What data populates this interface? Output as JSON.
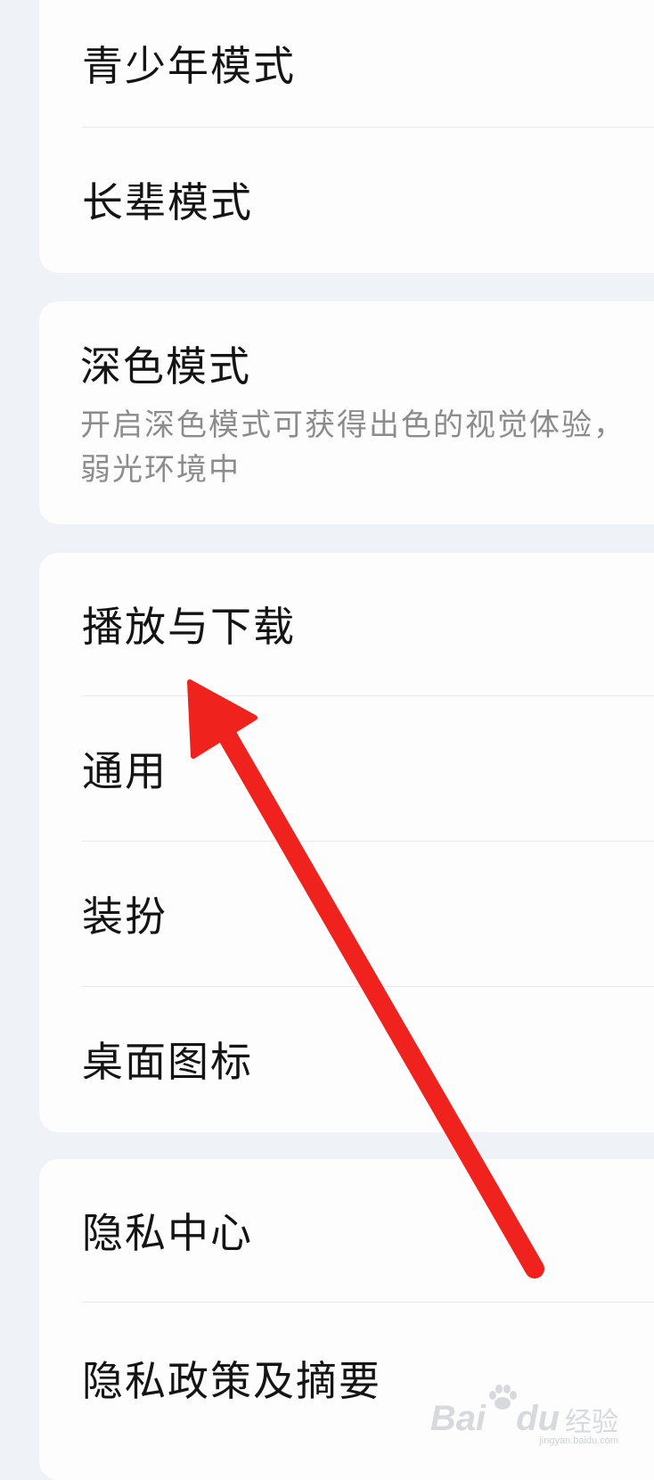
{
  "groups": [
    {
      "items": [
        {
          "label": "青少年模式"
        },
        {
          "label": "长辈模式"
        }
      ]
    },
    {
      "item": {
        "label": "深色模式",
        "description_line1": "开启深色模式可获得出色的视觉体验，",
        "description_line2": "弱光环境中"
      }
    },
    {
      "items": [
        {
          "label": "播放与下载"
        },
        {
          "label": "通用"
        },
        {
          "label": "装扮"
        },
        {
          "label": "桌面图标"
        }
      ]
    },
    {
      "items": [
        {
          "label": "隐私中心"
        },
        {
          "label": "隐私政策及摘要"
        }
      ]
    }
  ],
  "annotation": {
    "color": "#f0221e",
    "points_to": "播放与下载"
  },
  "watermark": {
    "brand": "Bai",
    "brand2": "du",
    "cn": "经验",
    "url": "jingyan.baidu.com"
  },
  "colors": {
    "background": "#eff2f7",
    "card": "#fdfdfd",
    "text": "#141414",
    "secondary_text": "#8c8c8c"
  }
}
